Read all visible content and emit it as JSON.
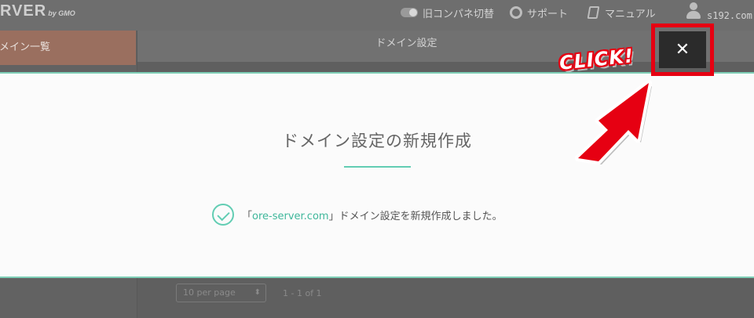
{
  "header": {
    "logo_text": "RVER",
    "logo_sub": "by GMO",
    "old_panel_label": "旧コンパネ切替",
    "support_label": "サポート",
    "manual_label": "マニュアル",
    "user_name": "s192.com"
  },
  "sidebar": {
    "active_item_label": "ドメイン一覧"
  },
  "main": {
    "page_title": "ドメイン設定",
    "per_page_label": "10 per page",
    "range_label": "1 - 1 of 1"
  },
  "modal": {
    "title": "ドメイン設定の新規作成",
    "message_prefix": "「",
    "domain": "ore-server.com",
    "message_suffix": "」ドメイン設定を新規作成しました。",
    "close_label": "✕"
  },
  "annotation": {
    "click_label": "CLICK!"
  },
  "colors": {
    "accent_teal": "#62cdb3",
    "callout_red": "#e60012"
  }
}
